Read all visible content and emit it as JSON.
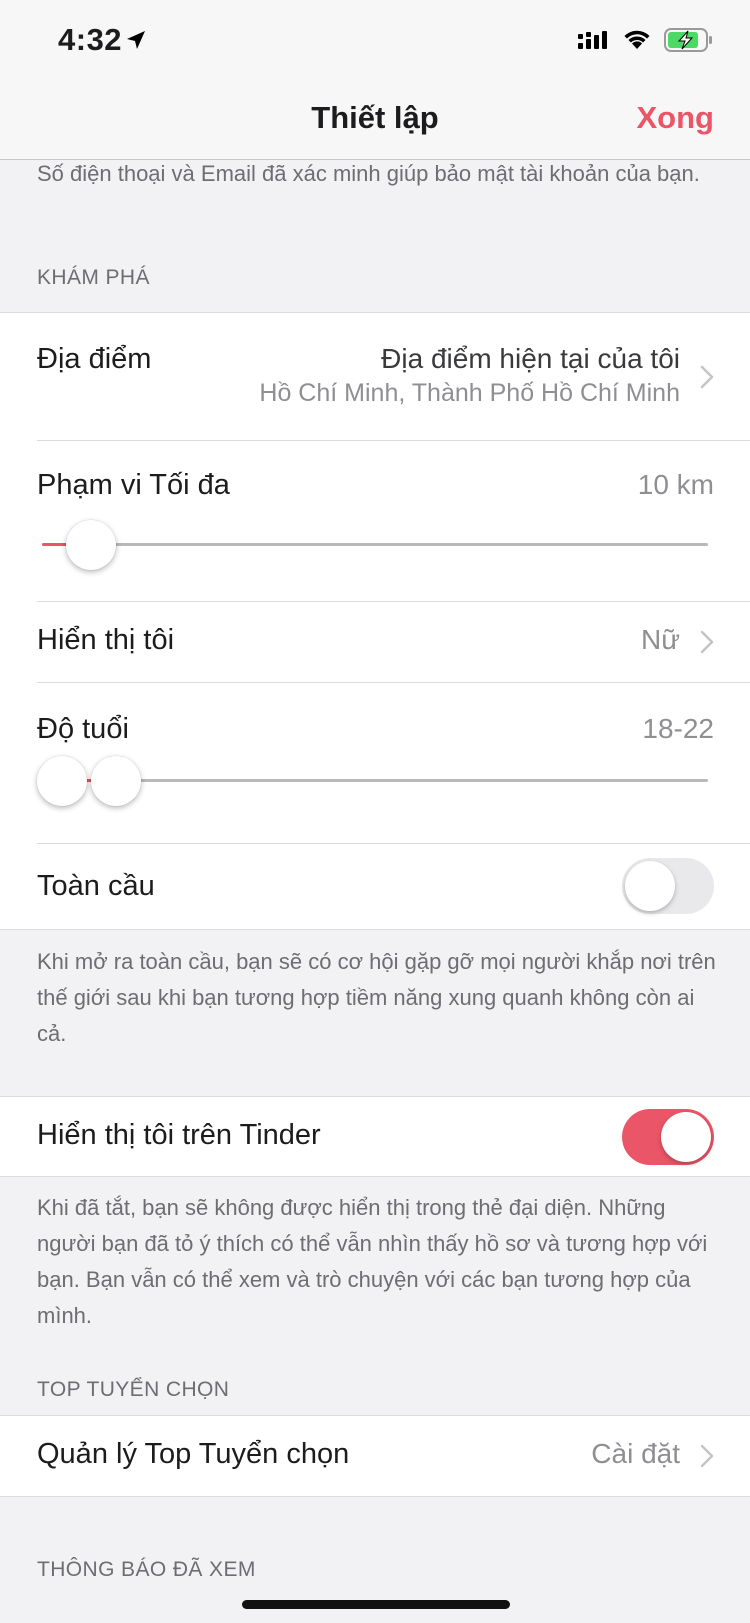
{
  "status_bar": {
    "time": "4:32"
  },
  "nav": {
    "title": "Thiết lập",
    "done": "Xong"
  },
  "intro_footer": "Số điện thoại và Email đã xác minh giúp bảo mật tài khoản của bạn.",
  "discover": {
    "header": "KHÁM PHÁ",
    "location": {
      "label": "Địa điểm",
      "value": "Địa điểm hiện tại của tôi",
      "subvalue": "Hồ Chí Minh, Thành Phố Hồ Chí Minh"
    },
    "max_distance": {
      "label": "Phạm vi Tối đa",
      "value": "10 km",
      "slider_fraction": 0.07
    },
    "show_me": {
      "label": "Hiển thị tôi",
      "value": "Nữ"
    },
    "age_range": {
      "label": "Độ tuổi",
      "value": "18-22",
      "min_fraction": 0.0,
      "max_fraction": 0.08
    },
    "global": {
      "label": "Toàn cầu",
      "enabled": false
    }
  },
  "global_footer": "Khi mở ra toàn cầu, bạn sẽ có cơ hội gặp gỡ mọi người khắp nơi trên thế giới sau khi bạn tương hợp tiềm năng xung quanh không còn ai cả.",
  "show_on_tinder": {
    "label": "Hiển thị tôi trên Tinder",
    "enabled": true
  },
  "show_on_tinder_footer": "Khi đã tắt, bạn sẽ không được hiển thị trong thẻ đại diện. Những người bạn đã tỏ ý thích có thể vẫn nhìn thấy hồ sơ và tương hợp với bạn. Bạn vẫn có thể xem và trò chuyện với các bạn tương hợp của mình.",
  "top_picks": {
    "header": "TOP TUYỂN CHỌN",
    "manage": {
      "label": "Quản lý Top Tuyển chọn",
      "value": "Cài đặt"
    }
  },
  "seen_notifications": {
    "header": "THÔNG BÁO ĐÃ XEM"
  },
  "colors": {
    "accent": "#ea5567",
    "background": "#f2f2f4",
    "secondary_text": "#8e8e93"
  }
}
